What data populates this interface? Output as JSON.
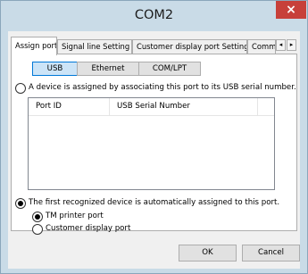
{
  "window": {
    "title": "COM2",
    "close_glyph": "×"
  },
  "tabs": [
    {
      "label": "Assign port",
      "active": true
    },
    {
      "label": "Signal line Setting",
      "active": false
    },
    {
      "label": "Customer display port Setting",
      "active": false
    },
    {
      "label": "Command (",
      "active": false
    }
  ],
  "tab_scroll": {
    "left": "◂",
    "right": "▸"
  },
  "segments": [
    {
      "label": "USB",
      "active": true
    },
    {
      "label": "Ethernet",
      "active": false
    },
    {
      "label": "COM/LPT",
      "active": false
    }
  ],
  "option_usb_assoc": {
    "label": "A device is assigned by associating this port to its USB serial number.",
    "checked": false
  },
  "listview": {
    "columns": [
      "Port ID",
      "USB Serial Number"
    ],
    "rows": []
  },
  "option_first_recognized": {
    "label": "The first recognized device is automatically assigned to this port.",
    "checked": true
  },
  "sub_tm_printer": {
    "label": "TM printer port",
    "checked": true
  },
  "sub_customer_display": {
    "label": "Customer display port",
    "checked": false
  },
  "buttons": {
    "ok": "OK",
    "cancel": "Cancel"
  },
  "colors": {
    "frame": "#c9dbe7",
    "close": "#c7403a",
    "active_segment": "#cce4f7",
    "active_border": "#0078d7"
  }
}
